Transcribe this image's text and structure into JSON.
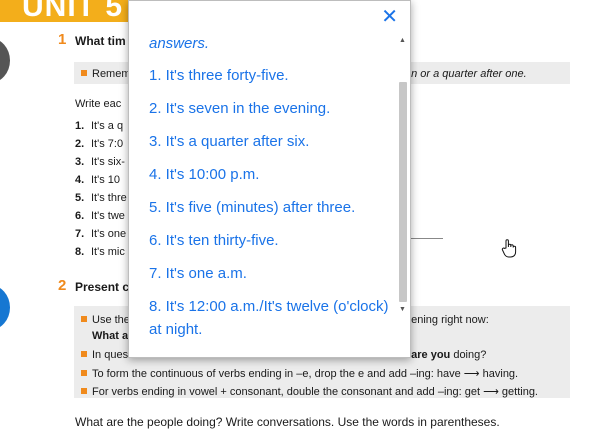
{
  "page": {
    "unit": "UNIT 5",
    "section1": {
      "number": "1",
      "title": "What tim",
      "remember_prefix": "Remem",
      "remember_suffix": "en or a quarter after one.",
      "instruction": "Write eac",
      "items": [
        {
          "num": "1.",
          "text": "It's a q"
        },
        {
          "num": "2.",
          "text": "It's 7:0"
        },
        {
          "num": "3.",
          "text": "It's six-"
        },
        {
          "num": "4.",
          "text": "It's 10"
        },
        {
          "num": "5.",
          "text": "It's thre"
        },
        {
          "num": "6.",
          "text": "It's twe"
        },
        {
          "num": "7.",
          "text": "It's one"
        },
        {
          "num": "8.",
          "text": "It's mic"
        }
      ]
    },
    "section2": {
      "number": "2",
      "title": "Present c",
      "bullet1_prefix": "Use the",
      "bullet1_suffix": "pening right now:",
      "bullet1_line2": "What a",
      "bullet2_prefix": "In ques",
      "bullet2_suffix_a": "t ",
      "bullet2_suffix_b": "are you",
      "bullet2_suffix_c": " doing?",
      "bullet3": "To form the continuous of verbs ending in –e, drop the e and add –ing: have ⟶ having.",
      "bullet4": "For verbs ending in vowel + consonant, double the consonant and add –ing: get ⟶ getting.",
      "instruction": "What are the people doing? Write conversations. Use the words in parentheses."
    }
  },
  "popup": {
    "close_symbol": "✕",
    "header": "answers.",
    "answers": [
      "1. It's three forty-five.",
      "2. It's seven in the evening.",
      "3. It's a quarter after six.",
      "4. It's 10:00 p.m.",
      "5. It's five (minutes) after three.",
      "6. It's ten thirty-five.",
      "7. It's one a.m.",
      "8. It's 12:00 a.m./It's twelve (o'clock) at night."
    ],
    "scroll_up": "▲",
    "scroll_down": "▼"
  },
  "colors": {
    "accent_orange": "#f08a1c",
    "banner": "#f3ae1b",
    "link_blue": "#1a73e8"
  },
  "icons": {
    "cursor": "hand-pointer-icon",
    "close": "close-icon"
  }
}
